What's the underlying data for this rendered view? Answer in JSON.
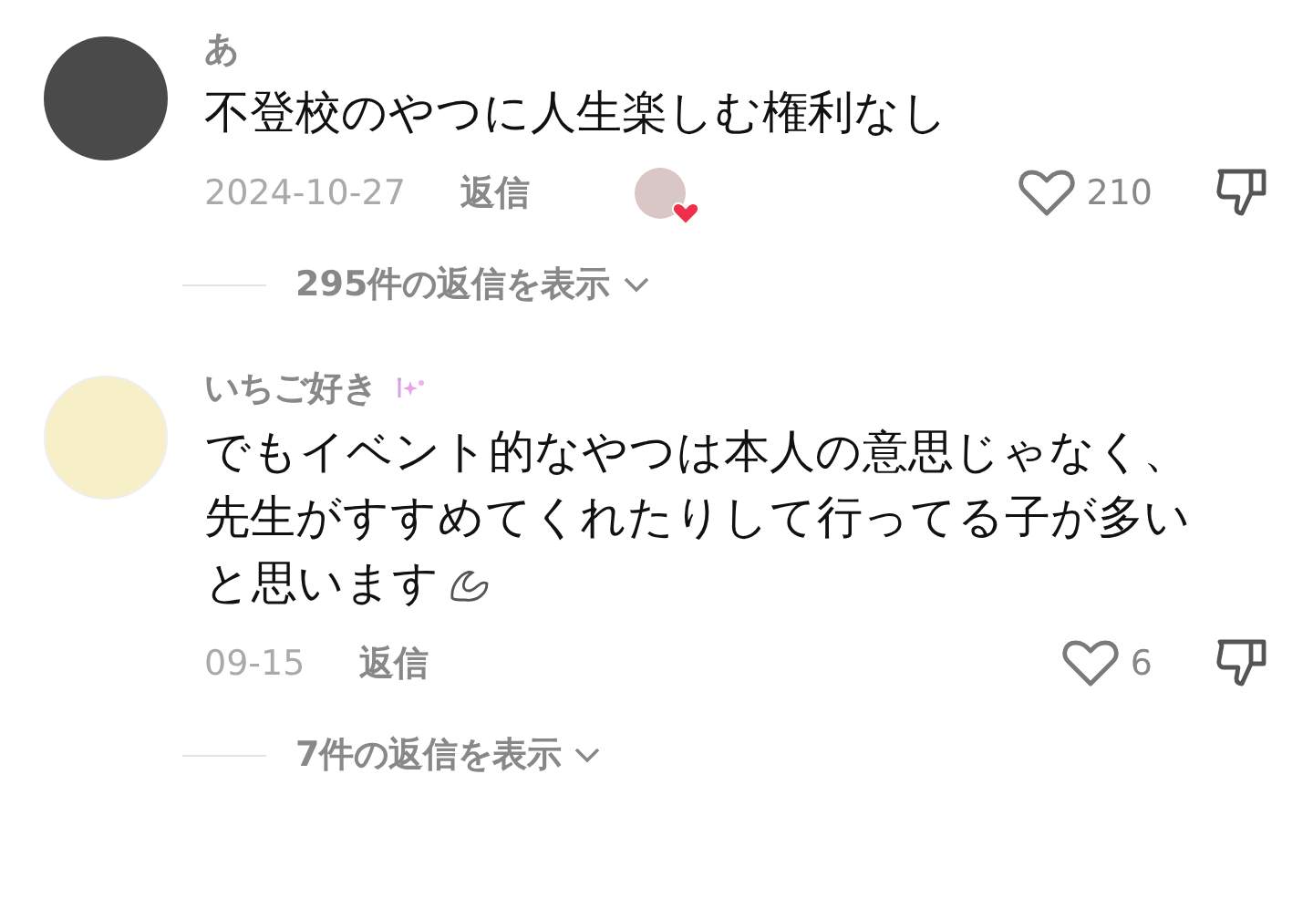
{
  "comments": [
    {
      "username": "あ",
      "name_emoji": false,
      "text": "不登校のやつに人生楽しむ権利なし",
      "text_emoji": false,
      "date": "2024-10-27",
      "reply": "返信",
      "liked_by_creator": true,
      "likes": "210",
      "view_replies": "295件の返信を表示"
    },
    {
      "username": "いちご好き",
      "name_emoji": true,
      "text": "でもイベント的なやつは本人の意思じゃなく、先生がすすめてくれたりして行ってる子が多いと思います",
      "text_emoji": true,
      "date": "09-15",
      "reply": "返信",
      "liked_by_creator": false,
      "likes": "6",
      "view_replies": "7件の返信を表示"
    }
  ]
}
